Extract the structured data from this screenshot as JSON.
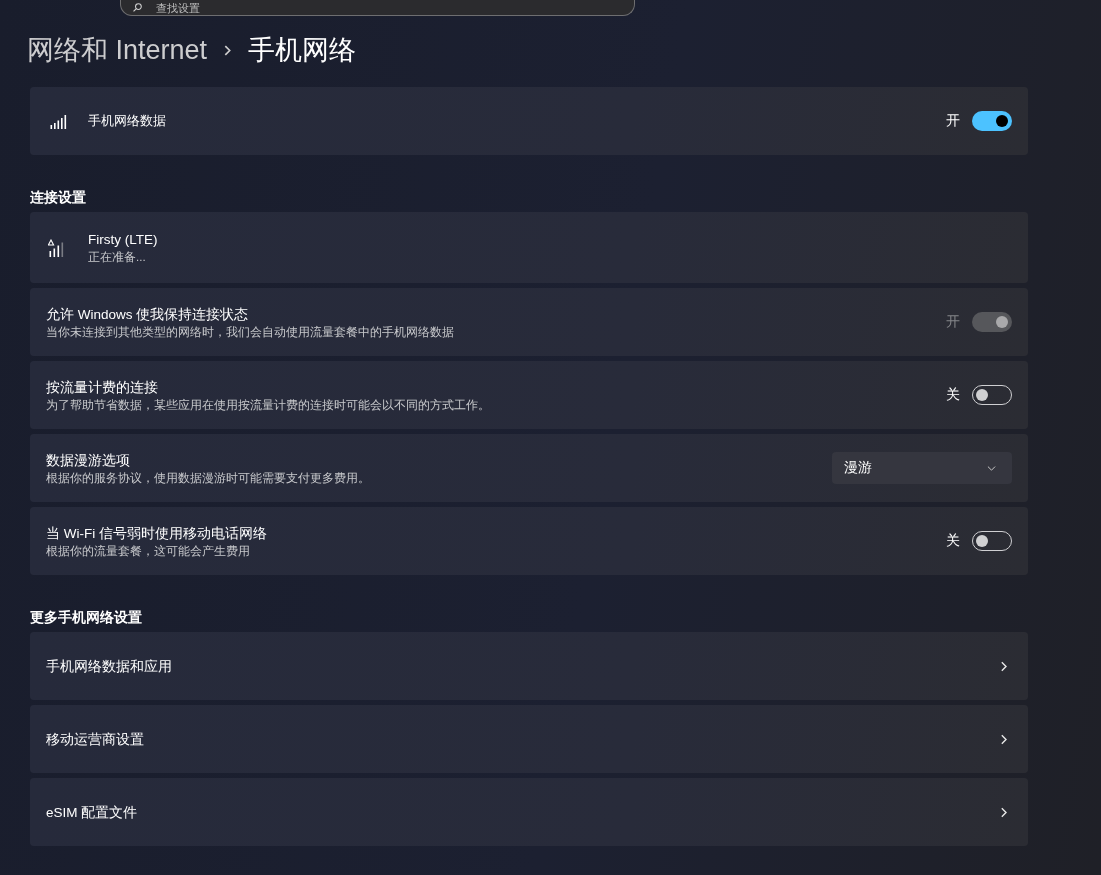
{
  "search": {
    "placeholder": "查找设置"
  },
  "breadcrumb": {
    "parent": "网络和 Internet",
    "current": "手机网络"
  },
  "cellular_data": {
    "label": "手机网络数据",
    "on": true,
    "disabled": false,
    "state_label": "开"
  },
  "sections": [
    {
      "title": "连接设置",
      "items": [
        {
          "kind": "network",
          "name": "Firsty (LTE)",
          "status": "正在准备..."
        },
        {
          "kind": "toggle",
          "title": "允许 Windows 使我保持连接状态",
          "description": "当你未连接到其他类型的网络时，我们会自动使用流量套餐中的手机网络数据",
          "on": true,
          "disabled": true,
          "state_label": "开"
        },
        {
          "kind": "toggle",
          "title": "按流量计费的连接",
          "description": "为了帮助节省数据，某些应用在使用按流量计费的连接时可能会以不同的方式工作。",
          "on": false,
          "disabled": false,
          "state_label": "关"
        },
        {
          "kind": "dropdown",
          "title": "数据漫游选项",
          "description": "根据你的服务协议，使用数据漫游时可能需要支付更多费用。",
          "value": "漫游"
        },
        {
          "kind": "toggle",
          "title": "当 Wi-Fi 信号弱时使用移动电话网络",
          "description": "根据你的流量套餐，这可能会产生费用",
          "on": false,
          "disabled": false,
          "state_label": "关"
        }
      ]
    },
    {
      "title": "更多手机网络设置",
      "items": [
        {
          "kind": "link",
          "title": "手机网络数据和应用"
        },
        {
          "kind": "link",
          "title": "移动运营商设置"
        },
        {
          "kind": "link",
          "title": "eSIM 配置文件"
        }
      ]
    }
  ]
}
